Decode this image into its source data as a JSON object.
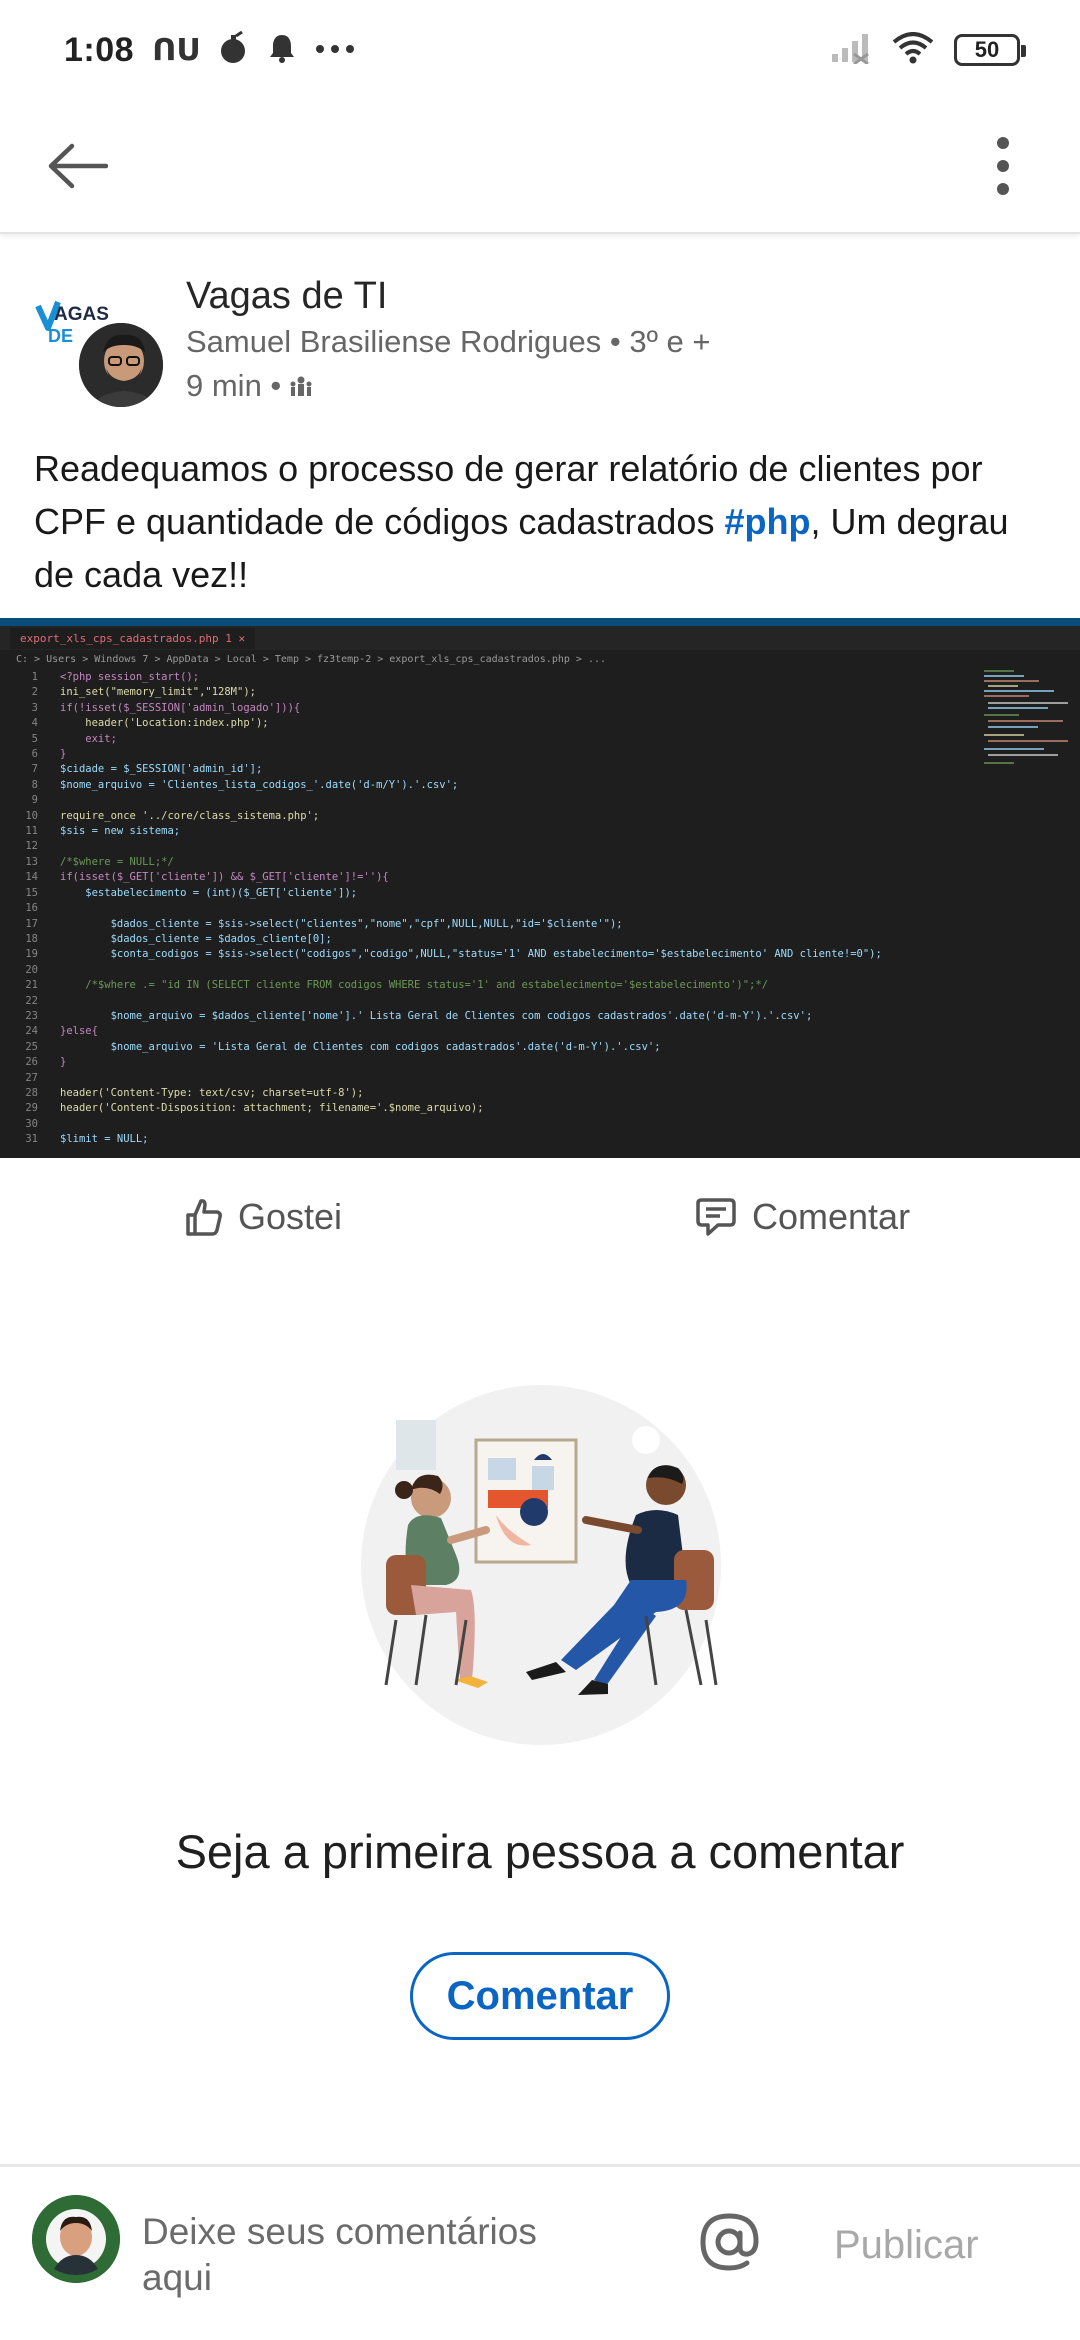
{
  "status_bar": {
    "time": "1:08",
    "carrier_glyph": "ᑎᑌ",
    "battery": "50",
    "icons": [
      "bomb-icon",
      "bell-icon",
      "more-dots-icon",
      "signal-icon",
      "wifi-icon",
      "battery-icon"
    ]
  },
  "header": {
    "back_icon": "arrow-left-icon",
    "menu_icon": "more-vertical-icon"
  },
  "post": {
    "group_name": "Vagas de TI",
    "author": "Samuel Brasiliense Rodrigues • 3º e +",
    "time": "9 min •",
    "visibility_icon": "group-icon",
    "text_before": "Readequamos o processo de gerar relatório de clientes por CPF e quantidade de códigos cadastrados ",
    "hashtag": "#php",
    "text_after": ", Um degrau de cada vez!!",
    "logo_text": "VAGAS DE"
  },
  "code_image": {
    "tab_label": "export_xls_cps_cadastrados.php 1 ✕",
    "breadcrumb": "C: > Users > Windows 7 > AppData > Local > Temp > fz3temp-2 > export_xls_cps_cadastrados.php > ...",
    "lines": [
      "<?php session_start();",
      "ini_set(\"memory_limit\",\"128M\");",
      "if(!isset($_SESSION['admin_logado'])){",
      "    header('Location:index.php');",
      "    exit;",
      "}",
      "$cidade = $_SESSION['admin_id'];",
      "$nome_arquivo = 'Clientes_lista_codigos_'.date('d-m/Y').'.csv';",
      "",
      "require_once '../core/class_sistema.php';",
      "$sis = new sistema;",
      "",
      "/*$where = NULL;*/",
      "if(isset($_GET['cliente']) && $_GET['cliente']!=''){",
      "    $estabelecimento = (int)($_GET['cliente']);",
      "",
      "        $dados_cliente = $sis->select(\"clientes\",\"nome\",\"cpf\",NULL,NULL,\"id='$cliente'\");",
      "        $dados_cliente = $dados_cliente[0];",
      "        $conta_codigos = $sis->select(\"codigos\",\"codigo\",NULL,\"status='1' AND estabelecimento='$estabelecimento' AND cliente!=0\");",
      "",
      "    /*$where .= \"id IN (SELECT cliente FROM codigos WHERE status='1' and estabelecimento='$estabelecimento')\";*/",
      "",
      "        $nome_arquivo = $dados_cliente['nome'].' Lista Geral de Clientes com codigos cadastrados'.date('d-m-Y').'.csv';",
      "}else{",
      "        $nome_arquivo = 'Lista Geral de Clientes com codigos cadastrados'.date('d-m-Y').'.csv';",
      "}",
      "",
      "header('Content-Type: text/csv; charset=utf-8');",
      "header('Content-Disposition: attachment; filename='.$nome_arquivo);",
      "",
      "$limit = NULL;"
    ]
  },
  "actions": {
    "like_label": "Gostei",
    "comment_label": "Comentar"
  },
  "empty_state": {
    "title": "Seja a primeira pessoa a comentar",
    "cta_label": "Comentar"
  },
  "composer": {
    "placeholder": "Deixe seus comentários aqui",
    "mention_symbol": "@",
    "publish_label": "Publicar"
  },
  "colors": {
    "accent": "#0a66c2",
    "code_bg": "#1e1e1e"
  }
}
